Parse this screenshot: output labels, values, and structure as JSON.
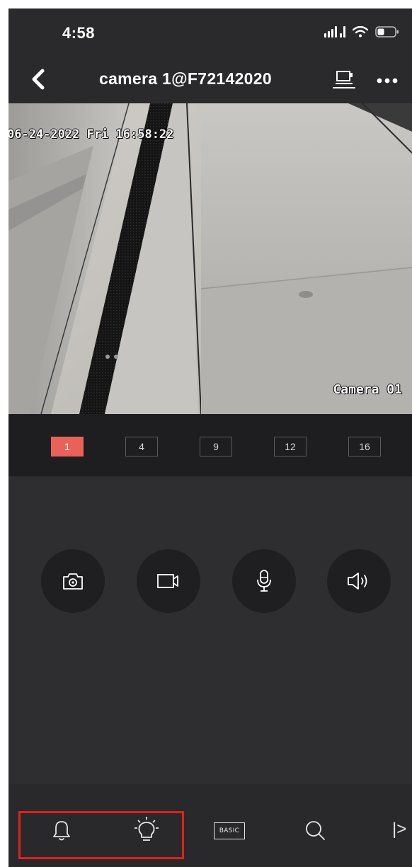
{
  "status_bar": {
    "time": "4:58",
    "signal_icon": "signal-bars-icon",
    "wifi_icon": "wifi-icon",
    "battery_icon": "battery-low-icon"
  },
  "nav": {
    "back_icon": "chevron-left-icon",
    "title": "camera 1@F72142020",
    "screen_icon": "cast-screen-icon",
    "more_icon": "ellipsis-icon"
  },
  "video": {
    "osd_datetime": "06-24-2022 Fri 16:58:22",
    "osd_camera_name": "Camera 01"
  },
  "split_options": [
    {
      "label": "1",
      "active": true
    },
    {
      "label": "4",
      "active": false
    },
    {
      "label": "9",
      "active": false
    },
    {
      "label": "12",
      "active": false
    },
    {
      "label": "16",
      "active": false
    }
  ],
  "controls": [
    {
      "name": "screenshot-button",
      "icon": "camera-icon"
    },
    {
      "name": "record-button",
      "icon": "video-record-icon"
    },
    {
      "name": "talk-button",
      "icon": "microphone-icon"
    },
    {
      "name": "audio-button",
      "icon": "speaker-icon"
    }
  ],
  "toolbar": {
    "alarm_icon": "bell-icon",
    "light_icon": "lightbulb-icon",
    "quality_label": "BASIC",
    "search_icon": "search-icon",
    "more_label": "|>"
  },
  "colors": {
    "accent": "#e8625a",
    "highlight_border": "#e0211c",
    "background": "#2c2c2e"
  }
}
